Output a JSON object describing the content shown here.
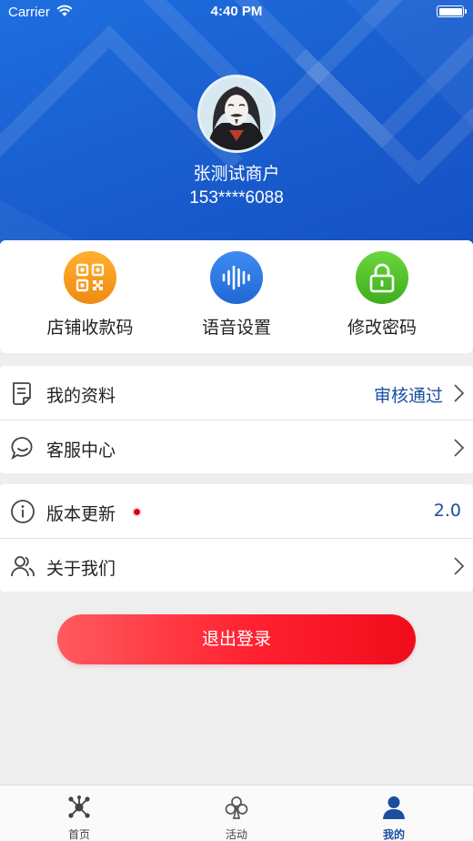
{
  "status_bar": {
    "carrier": "Carrier",
    "time": "4:40 PM"
  },
  "profile": {
    "name": "张测试商户",
    "phone": "153****6088"
  },
  "quick_actions": [
    {
      "label": "店铺收款码",
      "icon": "qr-code-icon",
      "color": "#f79a1c"
    },
    {
      "label": "语音设置",
      "icon": "voice-wave-icon",
      "color": "#2f7be6"
    },
    {
      "label": "修改密码",
      "icon": "lock-icon",
      "color": "#4fc328"
    }
  ],
  "menu_group1": [
    {
      "label": "我的资料",
      "icon": "document-icon",
      "status": "审核通过"
    },
    {
      "label": "客服中心",
      "icon": "chat-bubble-icon"
    }
  ],
  "menu_group2": [
    {
      "label": "版本更新",
      "icon": "info-icon",
      "version": "2.0"
    },
    {
      "label": "关于我们",
      "icon": "users-icon"
    }
  ],
  "logout_label": "退出登录",
  "tabs": [
    {
      "label": "首页",
      "icon": "hub-icon"
    },
    {
      "label": "活动",
      "icon": "club-icon"
    },
    {
      "label": "我的",
      "icon": "person-icon",
      "active": true
    }
  ],
  "colors": {
    "accent": "#1a4fa0",
    "header": "#1a5fd0",
    "logout": "#ff2130"
  }
}
